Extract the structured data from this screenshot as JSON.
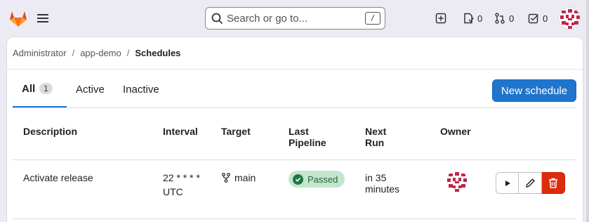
{
  "search": {
    "placeholder": "Search or go to...",
    "shortcut": "/"
  },
  "topbar": {
    "merge_requests_count": "0",
    "pipelines_count": "0",
    "todos_count": "0"
  },
  "breadcrumb": {
    "items": [
      "Administrator",
      "app-demo",
      "Schedules"
    ]
  },
  "tabs": [
    {
      "label": "All",
      "count": "1"
    },
    {
      "label": "Active"
    },
    {
      "label": "Inactive"
    }
  ],
  "new_schedule_label": "New schedule",
  "table": {
    "headers": [
      "Description",
      "Interval",
      "Target",
      "Last Pipeline",
      "Next Run",
      "Owner"
    ],
    "rows": [
      {
        "description": "Activate release",
        "interval": "22 * * * *",
        "timezone": "UTC",
        "target": "main",
        "status": "Passed",
        "next_run": "in 35 minutes"
      }
    ]
  },
  "colors": {
    "accent": "#1f75cb",
    "success": "#217645",
    "danger": "#dd2b0e",
    "brand": "#e24329"
  }
}
